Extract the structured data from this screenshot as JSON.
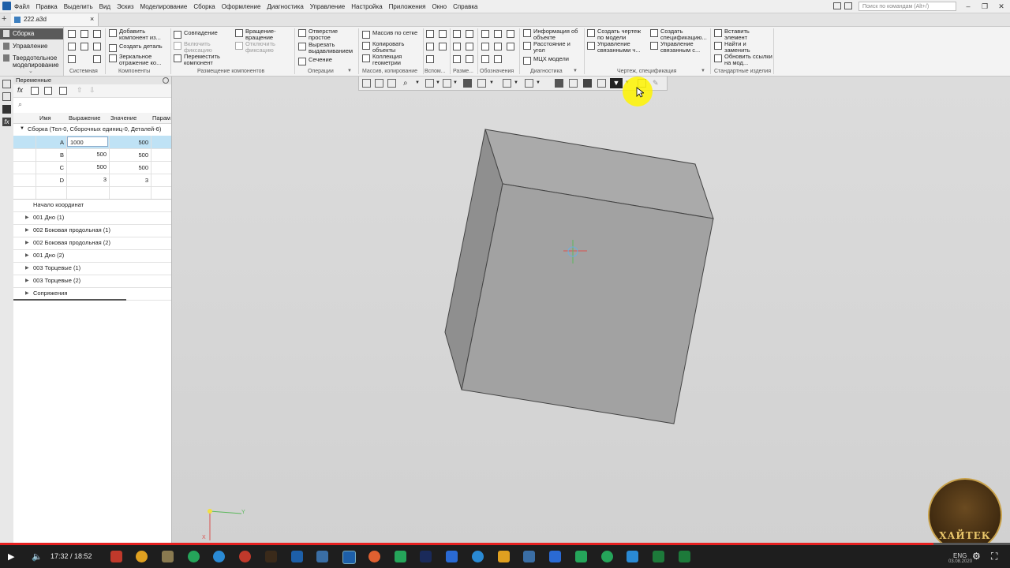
{
  "menu": {
    "items": [
      "Файл",
      "Правка",
      "Выделить",
      "Вид",
      "Эскиз",
      "Моделирование",
      "Сборка",
      "Оформление",
      "Диагностика",
      "Управление",
      "Настройка",
      "Приложения",
      "Окно",
      "Справка"
    ],
    "search_placeholder": "Поиск по командам (Alt+/)"
  },
  "tab": {
    "label": "222.a3d",
    "close": "×"
  },
  "nav": {
    "items": [
      {
        "label": "Сборка"
      },
      {
        "label": "Управление"
      },
      {
        "label": "Твердотельное моделирование"
      }
    ]
  },
  "ribbon": {
    "groups": [
      {
        "name": "Системная"
      },
      {
        "name": "Компоненты"
      },
      {
        "name": "Размещение компонентов"
      },
      {
        "name": "Операции"
      },
      {
        "name": "Массив, копирование"
      },
      {
        "name": "Вспом..."
      },
      {
        "name": "Разме..."
      },
      {
        "name": "Обозначения"
      },
      {
        "name": "Диагностика"
      },
      {
        "name": "Чертеж, спецификация"
      },
      {
        "name": "Стандартные изделия"
      }
    ],
    "buttons": {
      "add_component": "Добавить компонент из...",
      "create_part": "Создать деталь",
      "mirror": "Зеркальное отражение ко...",
      "coincidence": "Совпадение",
      "enable_fix": "Включить фиксацию",
      "move_component": "Переместить компонент",
      "rotation": "Вращение-вращение",
      "disable_fix": "Отключить фиксацию",
      "hole_simple": "Отверстие простое",
      "cut_extrude": "Вырезать выдавливанием",
      "section": "Сечение",
      "array_grid": "Массив по сетке",
      "copy_objects": "Копировать объекты",
      "geometry_collection": "Коллекция геометрии",
      "object_info": "Информация об объекте",
      "distance_angle": "Расстояние и угол",
      "mass_props": "МЦХ модели",
      "create_drawing": "Создать чертеж по модели",
      "manage_linked": "Управление связанными ч...",
      "create_spec": "Создать спецификацию...",
      "manage_linked_spec": "Управление связанным с...",
      "insert_element": "Вставить элемент",
      "find_replace": "Найти и заменить",
      "update_links": "Обновить ссылки на мод..."
    }
  },
  "variables": {
    "panel_title": "Переменные",
    "columns": [
      "Имя",
      "Выражение",
      "Значение",
      "Парам"
    ],
    "group_label": "Сборка (Тел-0, Сборочных единиц-0, Деталей-6)",
    "rows": [
      {
        "name": "A",
        "expression": "1000",
        "value": "500"
      },
      {
        "name": "B",
        "expression": "500",
        "value": "500"
      },
      {
        "name": "C",
        "expression": "500",
        "value": "500"
      },
      {
        "name": "D",
        "expression": "3",
        "value": "3"
      }
    ]
  },
  "tree": {
    "items": [
      {
        "label": "Начало координат"
      },
      {
        "label": "001 Дно  (1)"
      },
      {
        "label": "002 Боковая продольная  (1)"
      },
      {
        "label": "002 Боковая продольная  (2)"
      },
      {
        "label": "001 Дно  (2)"
      },
      {
        "label": "003 Торцевые  (1)"
      },
      {
        "label": "003 Торцевые  (2)"
      },
      {
        "label": "Сопряжения"
      }
    ]
  },
  "axis": {
    "y_label": "Y",
    "x_label": "X"
  },
  "player": {
    "time": "17:32 / 18:52",
    "progress": 0.924,
    "lang": "ENG",
    "date": "03.08.2020"
  },
  "logo": {
    "text": "ХАЙТЕК"
  },
  "colors": {
    "accent_red": "#e52020",
    "highlight": "#fff400",
    "selection": "#bfe2f5"
  }
}
